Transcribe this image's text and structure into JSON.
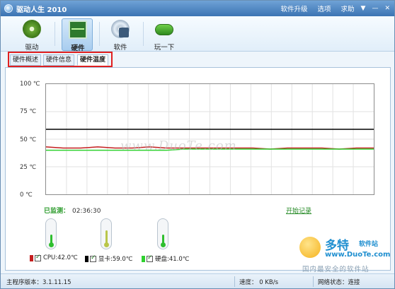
{
  "title": {
    "app": "驱动人生 2010"
  },
  "title_menu": {
    "upgrade": "软件升级",
    "options": "选项",
    "help": "求助",
    "ctl_menu": "▼",
    "ctl_min": "—",
    "ctl_close": "✕"
  },
  "toolbar": {
    "items": [
      {
        "label": "驱动",
        "icon": "gear-icon"
      },
      {
        "label": "硬件",
        "icon": "monitor-pulse-icon",
        "active": true
      },
      {
        "label": "软件",
        "icon": "cd-icon"
      },
      {
        "label": "玩一下",
        "icon": "gamepad-icon"
      }
    ]
  },
  "tabs": {
    "items": [
      "硬件概述",
      "硬件信息",
      "硬件温度"
    ],
    "active": 2
  },
  "chart_data": {
    "type": "line",
    "yticks": [
      "100 ℃",
      "75 ℃",
      "50 ℃",
      "25 ℃",
      "0 ℃"
    ],
    "ylim": [
      0,
      100
    ],
    "grid": true,
    "series": [
      {
        "name": "显卡",
        "color": "#000000",
        "values": [
          59,
          59,
          59,
          59,
          59,
          59,
          59,
          59,
          59,
          59,
          59,
          59,
          59,
          59,
          59,
          59,
          59,
          59,
          59,
          59
        ]
      },
      {
        "name": "CPU",
        "color": "#c41e1e",
        "values": [
          43,
          42,
          42,
          43,
          42,
          42,
          43,
          42,
          42,
          42,
          42,
          42,
          42,
          41,
          42,
          42,
          42,
          41,
          42,
          42
        ]
      },
      {
        "name": "硬盘",
        "color": "#2fd12f",
        "values": [
          40,
          40,
          40,
          40,
          40,
          40,
          40,
          40,
          41,
          41,
          41,
          41,
          41,
          41,
          41,
          41,
          41,
          41,
          41,
          41
        ]
      }
    ]
  },
  "monitor": {
    "label": "已监测：",
    "time": "02:36:30",
    "start_record": "开始记录"
  },
  "thermometers": [
    {
      "value": 42,
      "color": "#2fbf2f"
    },
    {
      "value": 59,
      "color": "#b9c64a"
    },
    {
      "value": 41,
      "color": "#2fbf2f"
    }
  ],
  "legend": [
    {
      "text": "CPU:42.0℃",
      "color": "#c41e1e"
    },
    {
      "text": "显卡:59.0℃",
      "color": "#000000"
    },
    {
      "text": "硬盘:41.0℃",
      "color": "#2fd12f"
    }
  ],
  "watermark": {
    "text": "www.DuoTe.com"
  },
  "duote": {
    "name": "多特",
    "sub": "软件站",
    "url": "www.DuoTe.com",
    "slogan": "国内最安全的软件站"
  },
  "status": {
    "version": "主程序版本：3.1.11.15",
    "speed": "速度： 0 KB/s",
    "network": "网络状态：连接"
  }
}
